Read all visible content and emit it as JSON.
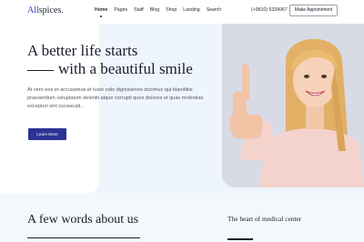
{
  "header": {
    "logo_prefix": "All",
    "logo_suffix": "spices.",
    "nav": [
      "Home",
      "Pages",
      "Staff",
      "Blog",
      "Shop",
      "Landing",
      "Search"
    ],
    "active_nav": "Home",
    "phone": "(+9810) 5334967",
    "appointment_label": "Make Appointment"
  },
  "hero": {
    "title_line1": "A better life starts",
    "title_line2": "with a beautiful smile",
    "text": "At vero eos et accusamus et iusto odio dignissimos ducimus qui blanditiis praesentium voluptatum deleniti atque corrupti quos dolores et quas molestias excepturi sint occaecati...",
    "button_label": "Learn More",
    "image_icon": "smiling-woman-thumbs-up-photo"
  },
  "about": {
    "title": "A few words about us",
    "side_title": "The heart of medical center"
  },
  "colors": {
    "accent": "#3a46c4",
    "button": "#2c3494",
    "panel": "#eef5fc",
    "text": "#1b1d2a"
  }
}
